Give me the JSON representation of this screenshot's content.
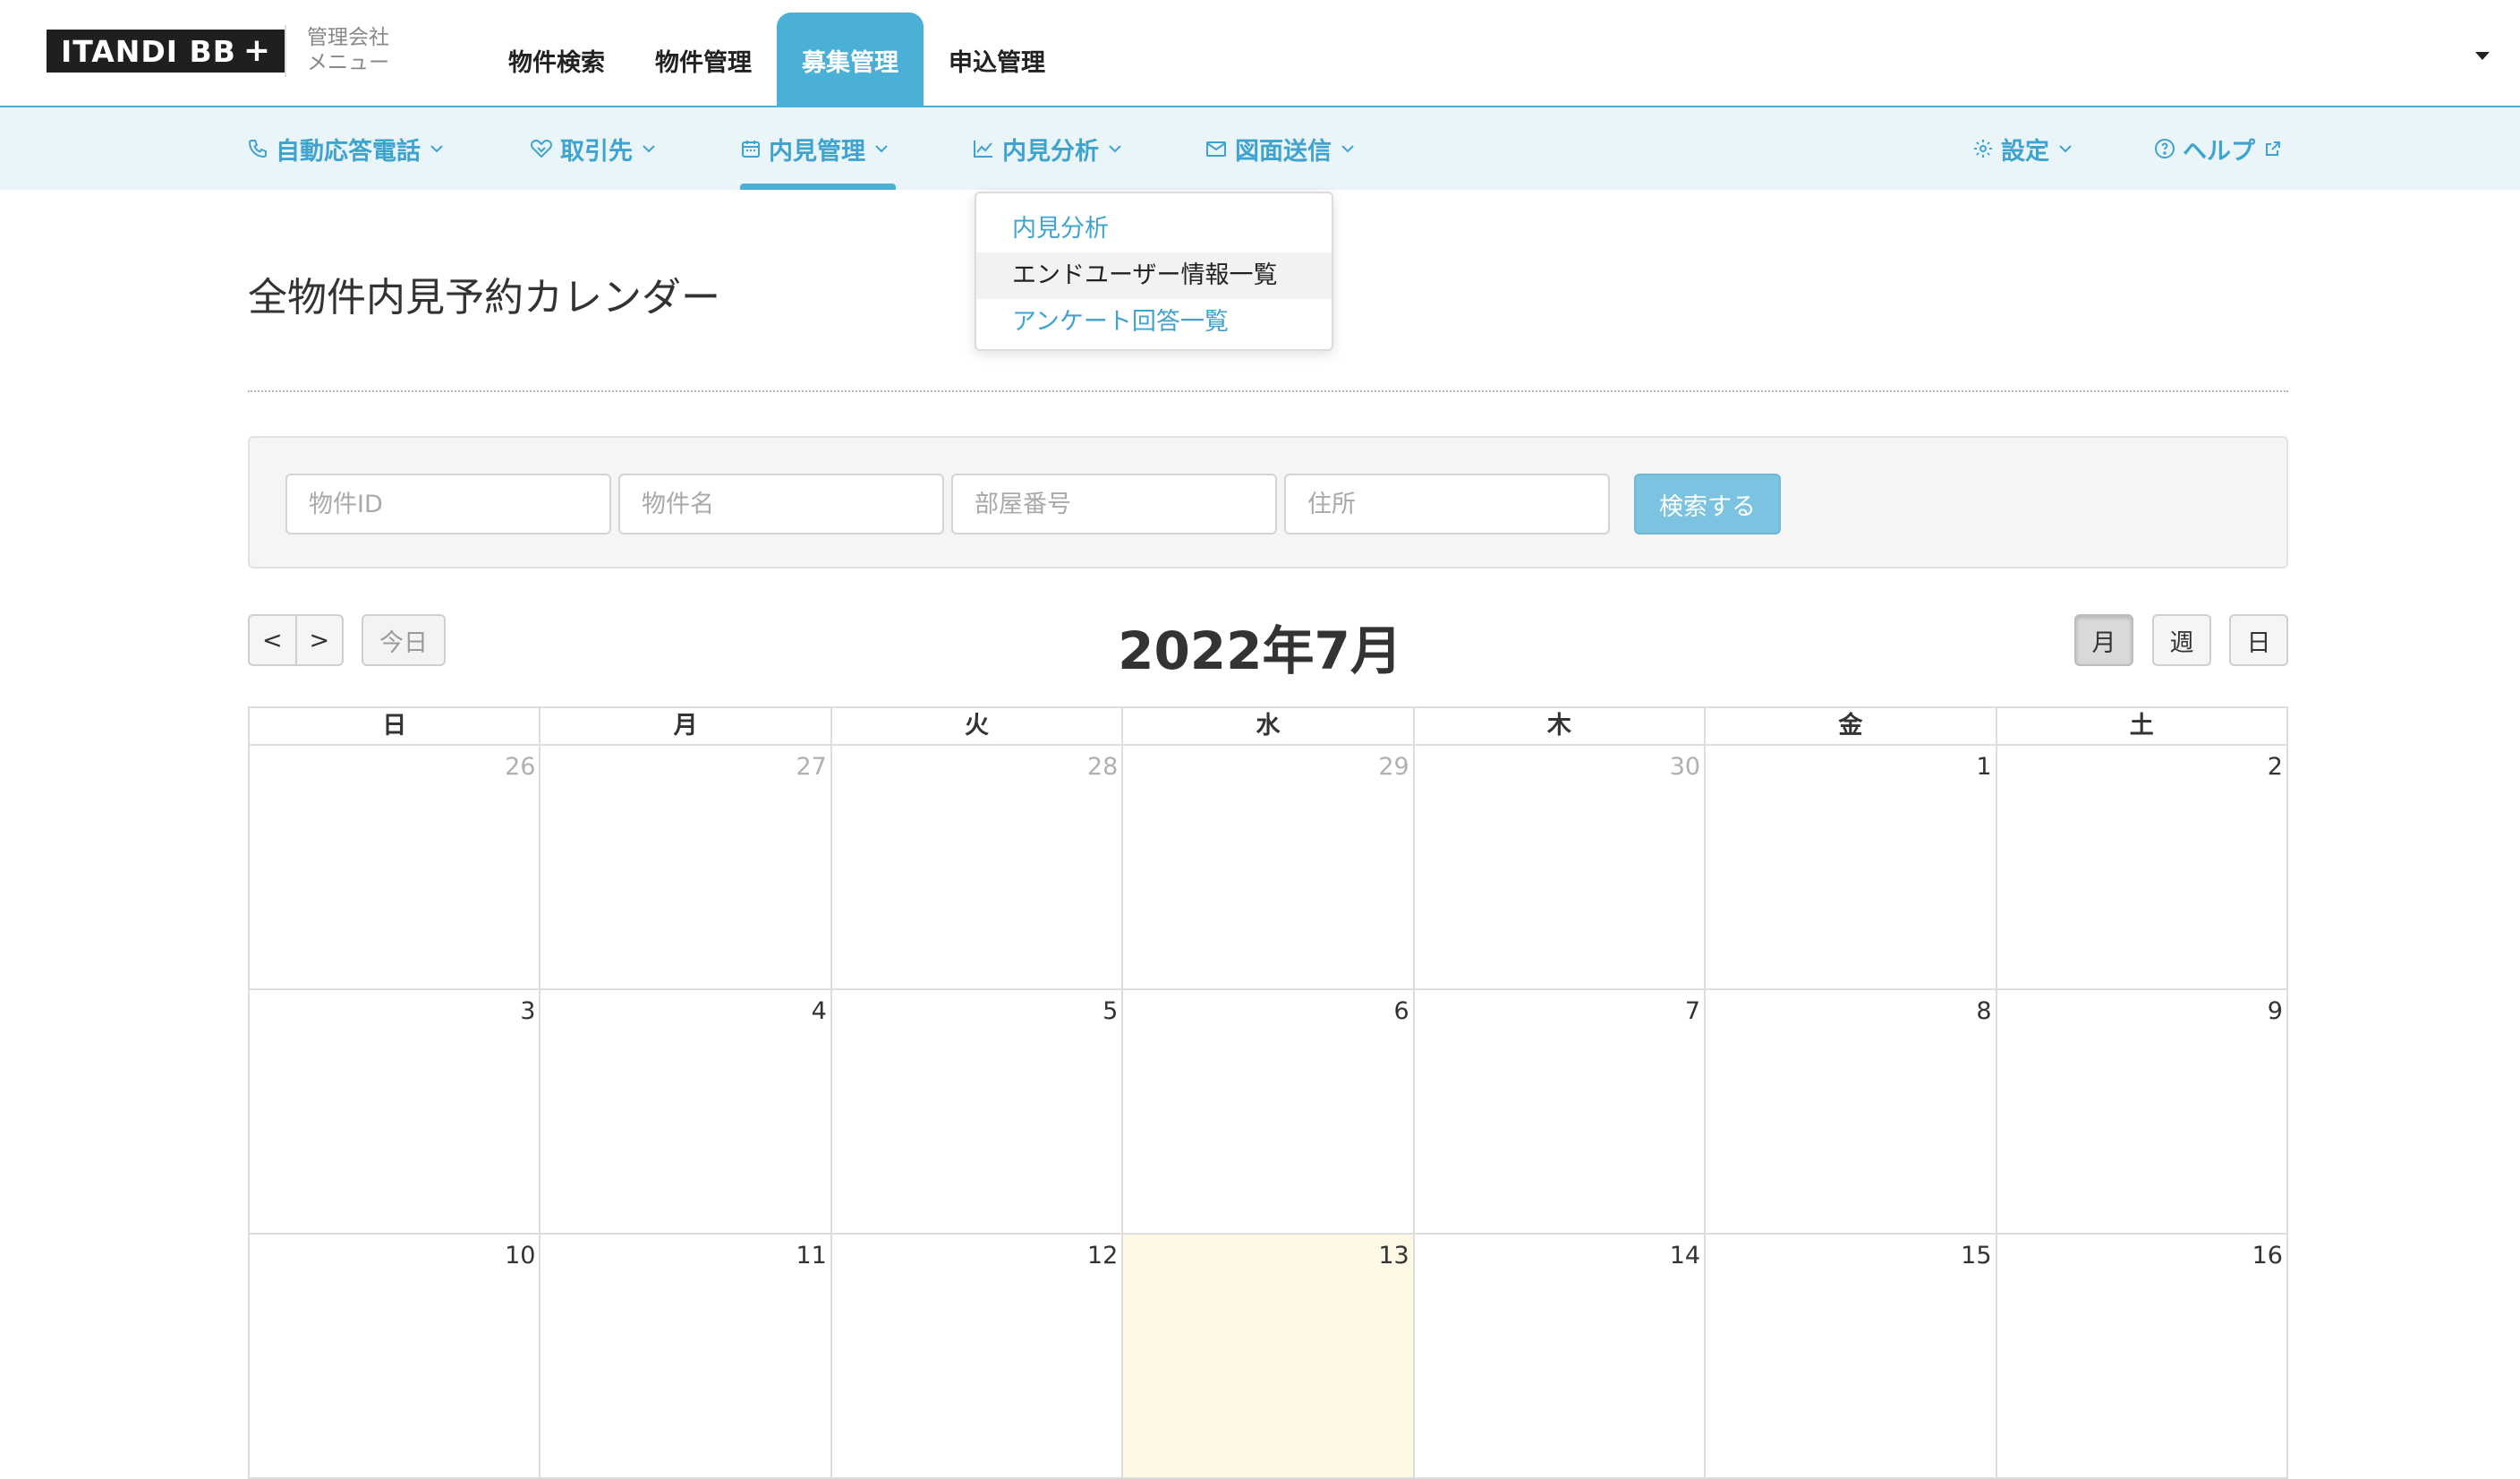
{
  "header": {
    "logo_text": "ITANDI BB",
    "logo_plus": "+",
    "company_menu_line1": "管理会社",
    "company_menu_line2": "メニュー",
    "tabs": [
      {
        "label": "物件検索"
      },
      {
        "label": "物件管理"
      },
      {
        "label": "募集管理"
      },
      {
        "label": "申込管理"
      }
    ]
  },
  "subnav": {
    "items": [
      {
        "label": "自動応答電話"
      },
      {
        "label": "取引先"
      },
      {
        "label": "内見管理"
      },
      {
        "label": "内見分析"
      },
      {
        "label": "図面送信"
      },
      {
        "label": "設定"
      },
      {
        "label": "ヘルプ"
      }
    ]
  },
  "dropdown": {
    "items": [
      {
        "label": "内見分析"
      },
      {
        "label": "エンドユーザー情報一覧"
      },
      {
        "label": "アンケート回答一覧"
      }
    ]
  },
  "page": {
    "title": "全物件内見予約カレンダー"
  },
  "search": {
    "property_id_placeholder": "物件ID",
    "property_name_placeholder": "物件名",
    "room_number_placeholder": "部屋番号",
    "address_placeholder": "住所",
    "submit_label": "検索する"
  },
  "calendar": {
    "prev_label": "<",
    "next_label": ">",
    "today_label": "今日",
    "title": "2022年7月",
    "view_month": "月",
    "view_week": "週",
    "view_day": "日",
    "weekdays": [
      "日",
      "月",
      "火",
      "水",
      "木",
      "金",
      "土"
    ],
    "weeks": [
      [
        "26",
        "27",
        "28",
        "29",
        "30",
        "1",
        "2"
      ],
      [
        "3",
        "4",
        "5",
        "6",
        "7",
        "8",
        "9"
      ],
      [
        "10",
        "11",
        "12",
        "13",
        "14",
        "15",
        "16"
      ]
    ],
    "today": "13"
  },
  "colors": {
    "brand": "#4ab0d6",
    "link": "#3fa3cf",
    "today_bg": "#fcf8e3"
  }
}
